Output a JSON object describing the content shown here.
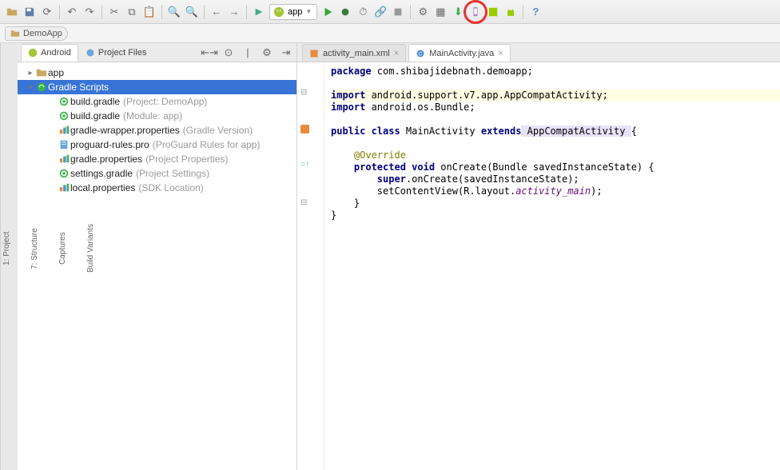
{
  "toolbar": {
    "run_config_label": "app"
  },
  "breadcrumb": {
    "items": [
      "DemoApp"
    ]
  },
  "left_gutter": {
    "tabs": [
      "1: Project",
      "7: Structure",
      "Captures",
      "Build Variants"
    ]
  },
  "project_panel": {
    "tabs": [
      {
        "label": "Android",
        "active": true
      },
      {
        "label": "Project Files",
        "active": false
      }
    ],
    "tree": [
      {
        "depth": 0,
        "arrow": "▸",
        "icon": "folder",
        "label": "app",
        "hint": ""
      },
      {
        "depth": 0,
        "arrow": "▾",
        "icon": "gradle-root",
        "label": "Gradle Scripts",
        "hint": "",
        "selected": true
      },
      {
        "depth": 1,
        "arrow": "",
        "icon": "gradle",
        "label": "build.gradle",
        "hint": "(Project: DemoApp)"
      },
      {
        "depth": 1,
        "arrow": "",
        "icon": "gradle",
        "label": "build.gradle",
        "hint": "(Module: app)"
      },
      {
        "depth": 1,
        "arrow": "",
        "icon": "props",
        "label": "gradle-wrapper.properties",
        "hint": "(Gradle Version)"
      },
      {
        "depth": 1,
        "arrow": "",
        "icon": "proguard",
        "label": "proguard-rules.pro",
        "hint": "(ProGuard Rules for app)"
      },
      {
        "depth": 1,
        "arrow": "",
        "icon": "props",
        "label": "gradle.properties",
        "hint": "(Project Properties)"
      },
      {
        "depth": 1,
        "arrow": "",
        "icon": "gradle",
        "label": "settings.gradle",
        "hint": "(Project Settings)"
      },
      {
        "depth": 1,
        "arrow": "",
        "icon": "props",
        "label": "local.properties",
        "hint": "(SDK Location)"
      }
    ]
  },
  "editor": {
    "tabs": [
      {
        "label": "activity_main.xml",
        "icon": "xml",
        "active": false
      },
      {
        "label": "MainActivity.java",
        "icon": "java",
        "active": true
      }
    ],
    "code": {
      "l1_kw": "package",
      "l1_rest": " com.shibajidebnath.demoapp;",
      "l3_kw": "import",
      "l3_rest": " android.support.v7.app.AppCompatActivity;",
      "l4_kw": "import",
      "l4_rest": " android.os.Bundle;",
      "l6_pub": "public ",
      "l6_cls": "class",
      "l6_name": " MainActivity ",
      "l6_ext": "extends",
      "l6_sup": " AppCompatActivity ",
      "l6_brace": "{",
      "l8_ann": "@Override",
      "l9_prot": "protected ",
      "l9_void": "void",
      "l9_sig": " onCreate(Bundle savedInstanceState) {",
      "l10_super": "super",
      "l10_rest": ".onCreate(savedInstanceState);",
      "l11_a": "setContentView(R.layout.",
      "l11_b": "activity_main",
      "l11_c": ");",
      "l12": "}",
      "l13": "}"
    }
  }
}
